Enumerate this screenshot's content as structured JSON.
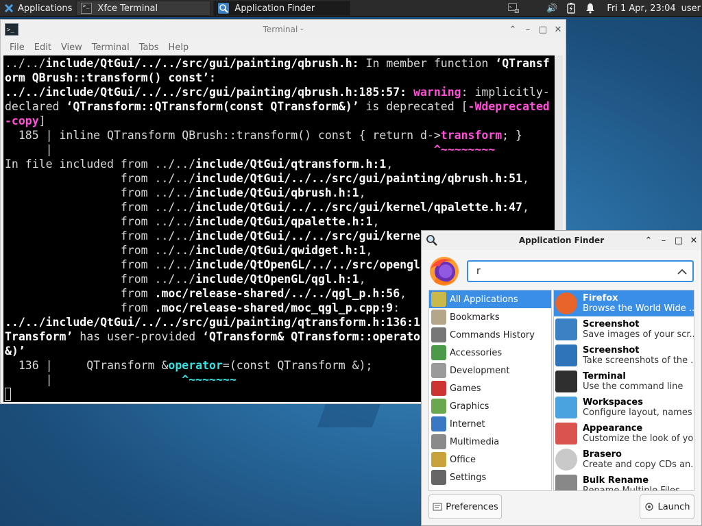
{
  "panel": {
    "applications_label": "Applications",
    "tasks": [
      {
        "label": "Xfce Terminal",
        "active": false
      },
      {
        "label": "Application Finder",
        "active": true
      }
    ],
    "clock": "Fri  1 Apr, 23:04",
    "user": "user"
  },
  "terminal": {
    "title": "Terminal -",
    "menu": [
      "File",
      "Edit",
      "View",
      "Terminal",
      "Tabs",
      "Help"
    ],
    "lines": [
      [
        {
          "t": "../../",
          "c": ""
        },
        {
          "t": "include/QtGui/../../src/gui/painting/qbrush.h:",
          "c": "b"
        },
        {
          "t": " In member function ",
          "c": ""
        },
        {
          "t": "‘QTransf",
          "c": "b"
        }
      ],
      [
        {
          "t": "orm QBrush::transform() const’:",
          "c": "b"
        }
      ],
      [
        {
          "t": "../../include/QtGui/../../src/gui/painting/qbrush.h:185:57:",
          "c": "b"
        },
        {
          "t": " ",
          "c": ""
        },
        {
          "t": "warning",
          "c": "mag"
        },
        {
          "t": ": implicitly-",
          "c": ""
        }
      ],
      [
        {
          "t": "declared ",
          "c": ""
        },
        {
          "t": "‘QTransform::QTransform(const QTransform&)’",
          "c": "b"
        },
        {
          "t": " is deprecated [",
          "c": ""
        },
        {
          "t": "-Wdeprecated",
          "c": "mag"
        }
      ],
      [
        {
          "t": "-copy",
          "c": "mag"
        },
        {
          "t": "]",
          "c": ""
        }
      ],
      [
        {
          "t": "  185 | inline QTransform QBrush::transform() const { return d->",
          "c": ""
        },
        {
          "t": "transform",
          "c": "mag"
        },
        {
          "t": "; }",
          "c": ""
        }
      ],
      [
        {
          "t": "      |                                                        ",
          "c": ""
        },
        {
          "t": "^~~~~~~~~",
          "c": "mag"
        }
      ],
      [
        {
          "t": "In file included from ../../",
          "c": ""
        },
        {
          "t": "include/QtGui/qtransform.h:1",
          "c": "b"
        },
        {
          "t": ",",
          "c": ""
        }
      ],
      [
        {
          "t": "                 from ../../",
          "c": ""
        },
        {
          "t": "include/QtGui/../../src/gui/painting/qbrush.h:51",
          "c": "b"
        },
        {
          "t": ",",
          "c": ""
        }
      ],
      [
        {
          "t": "                 from ../../",
          "c": ""
        },
        {
          "t": "include/QtGui/qbrush.h:1",
          "c": "b"
        },
        {
          "t": ",",
          "c": ""
        }
      ],
      [
        {
          "t": "                 from ../../",
          "c": ""
        },
        {
          "t": "include/QtGui/../../src/gui/kernel/qpalette.h:47",
          "c": "b"
        },
        {
          "t": ",",
          "c": ""
        }
      ],
      [
        {
          "t": "                 from ../../",
          "c": ""
        },
        {
          "t": "include/QtGui/qpalette.h:1",
          "c": "b"
        },
        {
          "t": ",",
          "c": ""
        }
      ],
      [
        {
          "t": "                 from ../../",
          "c": ""
        },
        {
          "t": "include/QtGui/../../src/gui/kerne",
          "c": "b"
        }
      ],
      [
        {
          "t": "                 from ../../",
          "c": ""
        },
        {
          "t": "include/QtGui/qwidget.h:1",
          "c": "b"
        },
        {
          "t": ",",
          "c": ""
        }
      ],
      [
        {
          "t": "                 from ../../",
          "c": ""
        },
        {
          "t": "include/QtOpenGL/../../src/opengl",
          "c": "b"
        }
      ],
      [
        {
          "t": "                 from ../../",
          "c": ""
        },
        {
          "t": "include/QtOpenGL/qgl.h:1",
          "c": "b"
        },
        {
          "t": ",",
          "c": ""
        }
      ],
      [
        {
          "t": "                 from ",
          "c": ""
        },
        {
          "t": ".moc/release-shared/../../qgl_p.h:56",
          "c": "b"
        },
        {
          "t": ",",
          "c": ""
        }
      ],
      [
        {
          "t": "                 from ",
          "c": ""
        },
        {
          "t": ".moc/release-shared/moc_qgl_p.cpp:9",
          "c": "b"
        },
        {
          "t": ":",
          "c": ""
        }
      ],
      [
        {
          "t": "../../include/QtGui/../../src/gui/painting/qtransform.h:136:1",
          "c": "b"
        }
      ],
      [
        {
          "t": "Transform’",
          "c": "b"
        },
        {
          "t": " has user-provided ",
          "c": ""
        },
        {
          "t": "‘QTransform& QTransform::operato",
          "c": "b"
        }
      ],
      [
        {
          "t": "&)’",
          "c": "b"
        }
      ],
      [
        {
          "t": "  136 |     QTransform &",
          "c": ""
        },
        {
          "t": "operator",
          "c": "cyan"
        },
        {
          "t": "=(const QTransform &);",
          "c": ""
        }
      ],
      [
        {
          "t": "      |                   ",
          "c": ""
        },
        {
          "t": "^~~~~~~~",
          "c": "cyan"
        }
      ]
    ]
  },
  "finder": {
    "title": "Application Finder",
    "search_value": "r",
    "categories": [
      {
        "label": "All Applications",
        "icon": "all-applications-icon",
        "color": "#c9b84a",
        "selected": true
      },
      {
        "label": "Bookmarks",
        "icon": "bookmarks-icon",
        "color": "#b5a58a",
        "selected": false
      },
      {
        "label": "Commands History",
        "icon": "commands-history-icon",
        "color": "#777777",
        "selected": false
      },
      {
        "label": "Accessories",
        "icon": "accessories-icon",
        "color": "#4a9a4a",
        "selected": false
      },
      {
        "label": "Development",
        "icon": "development-icon",
        "color": "#9a9a9a",
        "selected": false
      },
      {
        "label": "Games",
        "icon": "games-icon",
        "color": "#cc3333",
        "selected": false
      },
      {
        "label": "Graphics",
        "icon": "graphics-icon",
        "color": "#6aa84f",
        "selected": false
      },
      {
        "label": "Internet",
        "icon": "internet-icon",
        "color": "#3b78c4",
        "selected": false
      },
      {
        "label": "Multimedia",
        "icon": "multimedia-icon",
        "color": "#8a8a8a",
        "selected": false
      },
      {
        "label": "Office",
        "icon": "office-icon",
        "color": "#c8a23a",
        "selected": false
      },
      {
        "label": "Settings",
        "icon": "settings-icon",
        "color": "#666666",
        "selected": false
      }
    ],
    "apps": [
      {
        "name": "Firefox",
        "desc": "Browse the World Wide ...",
        "icon": "firefox-icon",
        "color": "#e8642b",
        "selected": true
      },
      {
        "name": "Screenshot",
        "desc": "Save images of your scr...",
        "icon": "screenshot-icon",
        "color": "#3a82c4",
        "selected": false
      },
      {
        "name": "Screenshot",
        "desc": "Take screenshots of the ...",
        "icon": "screenshot-tool-icon",
        "color": "#2f73b8",
        "selected": false
      },
      {
        "name": "Terminal",
        "desc": "Use the command line",
        "icon": "terminal-icon",
        "color": "#2f2f2f",
        "selected": false
      },
      {
        "name": "Workspaces",
        "desc": "Configure layout, names ...",
        "icon": "workspaces-icon",
        "color": "#4aa3df",
        "selected": false
      },
      {
        "name": "Appearance",
        "desc": "Customize the look of yo...",
        "icon": "appearance-icon",
        "color": "#d9534f",
        "selected": false
      },
      {
        "name": "Brasero",
        "desc": "Create and copy CDs an...",
        "icon": "brasero-icon",
        "color": "#c9c9c9",
        "selected": false
      },
      {
        "name": "Bulk Rename",
        "desc": "Rename Multiple Files",
        "icon": "bulk-rename-icon",
        "color": "#888888",
        "selected": false
      }
    ],
    "preferences_label": "Preferences",
    "launch_label": "Launch"
  }
}
